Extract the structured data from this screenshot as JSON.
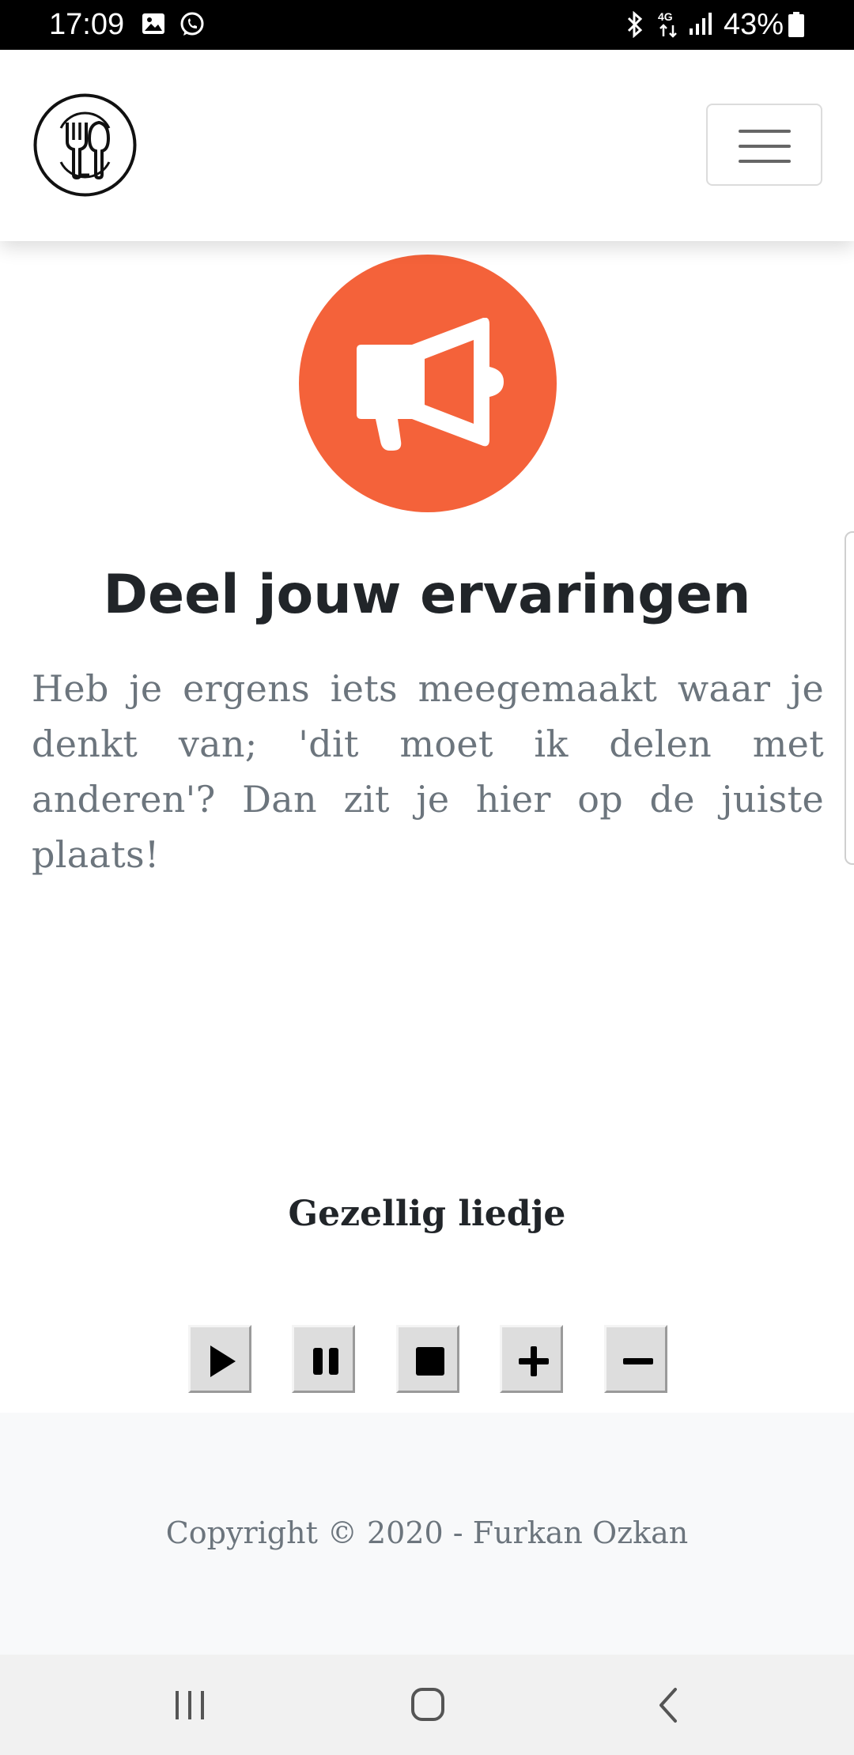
{
  "status_bar": {
    "time": "17:09",
    "battery": "43%",
    "icons": [
      "gallery-icon",
      "whatsapp-icon",
      "bluetooth-icon",
      "network-4g-icon",
      "signal-icon",
      "battery-icon"
    ]
  },
  "navbar": {
    "logo_icon": "cutlery-logo-icon",
    "menu_icon": "hamburger-menu-icon"
  },
  "hero": {
    "icon": "megaphone-icon",
    "accent_color": "#f4623a",
    "title": "Deel jouw ervaringen",
    "text": "Heb je ergens iets meegemaakt waar je denkt van; 'dit moet ik delen met anderen'? Dan zit je hier op de juiste plaats!"
  },
  "player": {
    "title": "Gezellig liedje",
    "controls": [
      "play-icon",
      "pause-icon",
      "stop-icon",
      "plus-icon",
      "minus-icon"
    ]
  },
  "footer": {
    "copyright": "Copyright © 2020 - Furkan Ozkan"
  },
  "system_nav": {
    "buttons": [
      "recent-apps-icon",
      "home-icon",
      "back-icon"
    ]
  }
}
